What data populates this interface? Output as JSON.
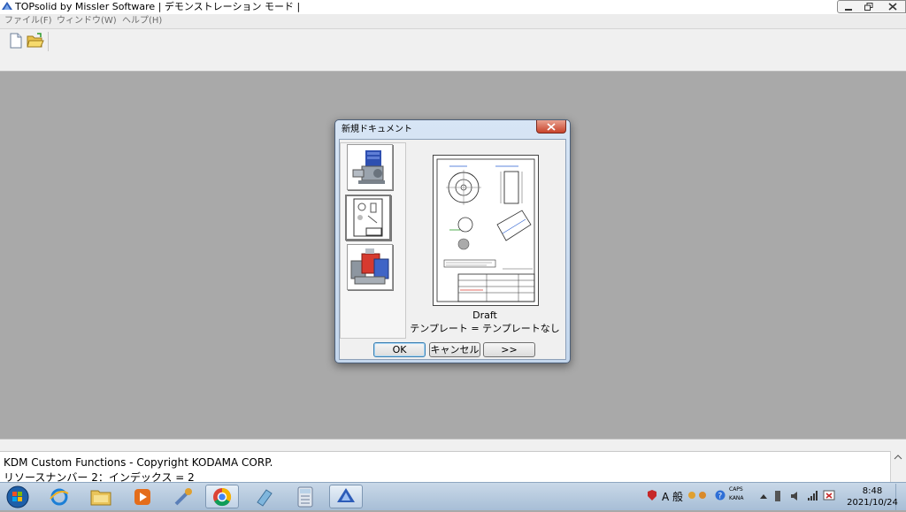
{
  "window": {
    "title": "TOPsolid by Missler Software | デモンストレーション モード |"
  },
  "menu": {
    "file": "ファイル(F)",
    "window": "ウィンドウ(W)",
    "help": "ヘルプ(H)"
  },
  "toolbar": {
    "icons": [
      "new-document-icon",
      "open-folder-icon"
    ]
  },
  "console": {
    "line1": "KDM Custom Functions - Copyright KODAMA CORP.",
    "line2": "リソースナンバー 2：インデックス = 2"
  },
  "dialog": {
    "title": "新規ドキュメント",
    "templates": [
      "part",
      "draft",
      "assembly"
    ],
    "selected_template": "draft",
    "preview_name": "Draft",
    "preview_template_line": "テンプレート = テンプレートなし",
    "ok_label": "OK",
    "cancel_label": "キャンセル",
    "next_label": ">>"
  },
  "taskbar": {
    "apps": [
      "start-orb",
      "internet-explorer",
      "file-explorer",
      "media-player",
      "tool-app",
      "chrome",
      "notes-app",
      "calculator",
      "topsolid"
    ],
    "ime_mode": "A 般",
    "caps": "CAPS",
    "kana": "KANA",
    "time": "8:48",
    "date": "2021/10/24"
  },
  "colors": {
    "workspace": "#a9a9a9",
    "dialog_frame": "#c3d6ec",
    "close_red": "#c8432b",
    "taskbar": "#b4c8de"
  }
}
